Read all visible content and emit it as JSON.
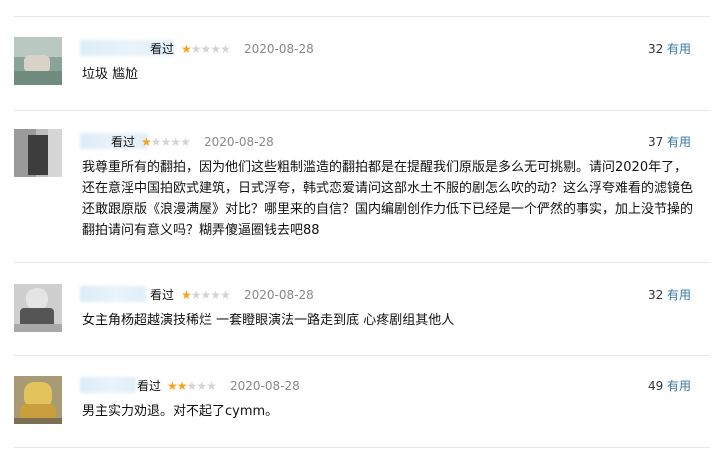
{
  "comments": [
    {
      "status": "看过",
      "rating": 1,
      "date": "2020-08-28",
      "votes": "32",
      "useful_label": "有用",
      "content_lines": [
        "垃圾 尴尬"
      ]
    },
    {
      "status": "看过",
      "rating": 1,
      "date": "2020-08-28",
      "votes": "37",
      "useful_label": "有用",
      "content_lines": [
        "我尊重所有的翻拍，因为他们这些粗制滥造的翻拍都是在提醒我们原版是多么无可挑剔。请问2020年了，",
        "还在意淫中国拍欧式建筑，日式浮夸，韩式恋爱请问这部水土不服的剧怎么吹的动？这么浮夸难看的滤镜色",
        "还敢跟原版《浪漫满屋》对比？哪里来的自信？国内编剧创作力低下已经是一个俨然的事实，加上没节操的",
        "翻拍请问有意义吗？糊弄傻逼圈钱去吧88"
      ]
    },
    {
      "status": "看过",
      "rating": 1,
      "date": "2020-08-28",
      "votes": "32",
      "useful_label": "有用",
      "content_lines": [
        "女主角杨超越演技稀烂 一套瞪眼演法一路走到底 心疼剧组其他人"
      ]
    },
    {
      "status": "看过",
      "rating": 2,
      "date": "2020-08-28",
      "votes": "49",
      "useful_label": "有用",
      "content_lines": [
        "男主实力劝退。对不起了cymm。"
      ]
    }
  ],
  "colors": {
    "star_on": "#f7a21b",
    "star_off": "#d4d4d4",
    "link": "#3377aa",
    "date": "#888888"
  },
  "icons": {
    "star_filled": "★",
    "star_empty": "★"
  }
}
